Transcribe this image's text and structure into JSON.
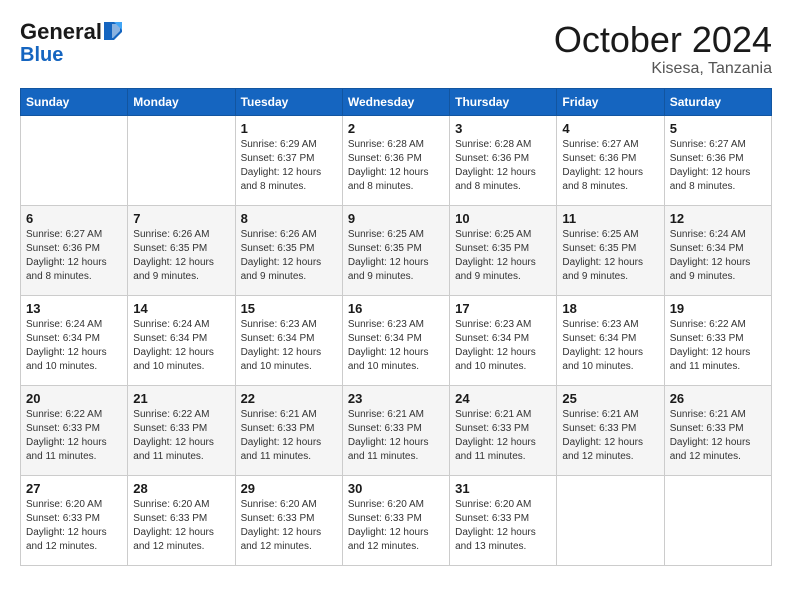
{
  "header": {
    "logo_line1": "General",
    "logo_line2": "Blue",
    "month_title": "October 2024",
    "location": "Kisesa, Tanzania"
  },
  "weekdays": [
    "Sunday",
    "Monday",
    "Tuesday",
    "Wednesday",
    "Thursday",
    "Friday",
    "Saturday"
  ],
  "weeks": [
    [
      {
        "day": "",
        "info": ""
      },
      {
        "day": "",
        "info": ""
      },
      {
        "day": "1",
        "info": "Sunrise: 6:29 AM\nSunset: 6:37 PM\nDaylight: 12 hours and 8 minutes."
      },
      {
        "day": "2",
        "info": "Sunrise: 6:28 AM\nSunset: 6:36 PM\nDaylight: 12 hours and 8 minutes."
      },
      {
        "day": "3",
        "info": "Sunrise: 6:28 AM\nSunset: 6:36 PM\nDaylight: 12 hours and 8 minutes."
      },
      {
        "day": "4",
        "info": "Sunrise: 6:27 AM\nSunset: 6:36 PM\nDaylight: 12 hours and 8 minutes."
      },
      {
        "day": "5",
        "info": "Sunrise: 6:27 AM\nSunset: 6:36 PM\nDaylight: 12 hours and 8 minutes."
      }
    ],
    [
      {
        "day": "6",
        "info": "Sunrise: 6:27 AM\nSunset: 6:36 PM\nDaylight: 12 hours and 8 minutes."
      },
      {
        "day": "7",
        "info": "Sunrise: 6:26 AM\nSunset: 6:35 PM\nDaylight: 12 hours and 9 minutes."
      },
      {
        "day": "8",
        "info": "Sunrise: 6:26 AM\nSunset: 6:35 PM\nDaylight: 12 hours and 9 minutes."
      },
      {
        "day": "9",
        "info": "Sunrise: 6:25 AM\nSunset: 6:35 PM\nDaylight: 12 hours and 9 minutes."
      },
      {
        "day": "10",
        "info": "Sunrise: 6:25 AM\nSunset: 6:35 PM\nDaylight: 12 hours and 9 minutes."
      },
      {
        "day": "11",
        "info": "Sunrise: 6:25 AM\nSunset: 6:35 PM\nDaylight: 12 hours and 9 minutes."
      },
      {
        "day": "12",
        "info": "Sunrise: 6:24 AM\nSunset: 6:34 PM\nDaylight: 12 hours and 9 minutes."
      }
    ],
    [
      {
        "day": "13",
        "info": "Sunrise: 6:24 AM\nSunset: 6:34 PM\nDaylight: 12 hours and 10 minutes."
      },
      {
        "day": "14",
        "info": "Sunrise: 6:24 AM\nSunset: 6:34 PM\nDaylight: 12 hours and 10 minutes."
      },
      {
        "day": "15",
        "info": "Sunrise: 6:23 AM\nSunset: 6:34 PM\nDaylight: 12 hours and 10 minutes."
      },
      {
        "day": "16",
        "info": "Sunrise: 6:23 AM\nSunset: 6:34 PM\nDaylight: 12 hours and 10 minutes."
      },
      {
        "day": "17",
        "info": "Sunrise: 6:23 AM\nSunset: 6:34 PM\nDaylight: 12 hours and 10 minutes."
      },
      {
        "day": "18",
        "info": "Sunrise: 6:23 AM\nSunset: 6:34 PM\nDaylight: 12 hours and 10 minutes."
      },
      {
        "day": "19",
        "info": "Sunrise: 6:22 AM\nSunset: 6:33 PM\nDaylight: 12 hours and 11 minutes."
      }
    ],
    [
      {
        "day": "20",
        "info": "Sunrise: 6:22 AM\nSunset: 6:33 PM\nDaylight: 12 hours and 11 minutes."
      },
      {
        "day": "21",
        "info": "Sunrise: 6:22 AM\nSunset: 6:33 PM\nDaylight: 12 hours and 11 minutes."
      },
      {
        "day": "22",
        "info": "Sunrise: 6:21 AM\nSunset: 6:33 PM\nDaylight: 12 hours and 11 minutes."
      },
      {
        "day": "23",
        "info": "Sunrise: 6:21 AM\nSunset: 6:33 PM\nDaylight: 12 hours and 11 minutes."
      },
      {
        "day": "24",
        "info": "Sunrise: 6:21 AM\nSunset: 6:33 PM\nDaylight: 12 hours and 11 minutes."
      },
      {
        "day": "25",
        "info": "Sunrise: 6:21 AM\nSunset: 6:33 PM\nDaylight: 12 hours and 12 minutes."
      },
      {
        "day": "26",
        "info": "Sunrise: 6:21 AM\nSunset: 6:33 PM\nDaylight: 12 hours and 12 minutes."
      }
    ],
    [
      {
        "day": "27",
        "info": "Sunrise: 6:20 AM\nSunset: 6:33 PM\nDaylight: 12 hours and 12 minutes."
      },
      {
        "day": "28",
        "info": "Sunrise: 6:20 AM\nSunset: 6:33 PM\nDaylight: 12 hours and 12 minutes."
      },
      {
        "day": "29",
        "info": "Sunrise: 6:20 AM\nSunset: 6:33 PM\nDaylight: 12 hours and 12 minutes."
      },
      {
        "day": "30",
        "info": "Sunrise: 6:20 AM\nSunset: 6:33 PM\nDaylight: 12 hours and 12 minutes."
      },
      {
        "day": "31",
        "info": "Sunrise: 6:20 AM\nSunset: 6:33 PM\nDaylight: 12 hours and 13 minutes."
      },
      {
        "day": "",
        "info": ""
      },
      {
        "day": "",
        "info": ""
      }
    ]
  ]
}
